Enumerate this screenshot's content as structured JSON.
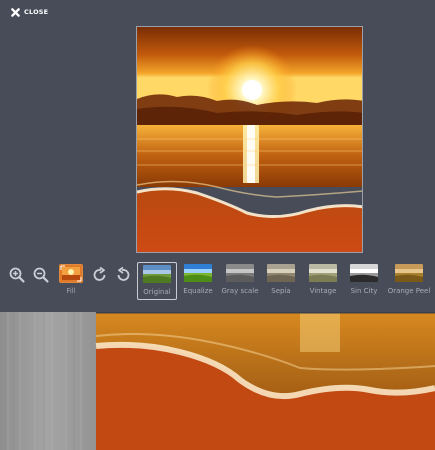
{
  "close": {
    "label": "CLOSE"
  },
  "toolbar": {
    "zoom_in": "zoom-in-icon",
    "zoom_out": "zoom-out-icon",
    "fill_label": "Fill",
    "rotate_right": "rotate-right-icon",
    "rotate_left": "rotate-left-icon"
  },
  "filters": [
    {
      "label": "Original",
      "selected": true
    },
    {
      "label": "Equalize",
      "selected": false
    },
    {
      "label": "Gray scale",
      "selected": false
    },
    {
      "label": "Sepia",
      "selected": false
    },
    {
      "label": "Vintage",
      "selected": false
    },
    {
      "label": "Sin City",
      "selected": false
    },
    {
      "label": "Orange Peel",
      "selected": false
    }
  ],
  "colors": {
    "editor_bg": "#474c58",
    "accent_orange": "#e07a2a",
    "text_muted": "#a7acb5"
  }
}
